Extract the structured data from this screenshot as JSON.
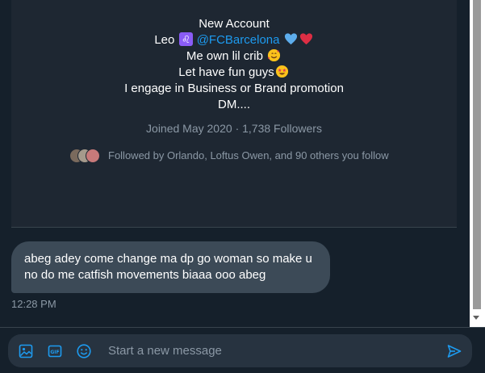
{
  "profile": {
    "bio_lines": [
      "New Account",
      "Leo",
      "@FCBarcelona",
      "Me own lil crib",
      "Let have fun guys",
      "I engage in Business or Brand promotion",
      "DM...."
    ],
    "joined": "Joined May 2020",
    "separator": "·",
    "followers": "1,738 Followers",
    "followed_by": "Followed by Orlando, Loftus Owen, and 90 others you follow"
  },
  "message": {
    "text": "abeg adey come change ma dp go woman so make u no do me catfish movements biaaa ooo abeg",
    "time": "12:28 PM"
  },
  "composer": {
    "placeholder": "Start a new message"
  },
  "icons": {
    "media": "image-icon",
    "gif": "gif-icon",
    "emoji": "emoji-icon",
    "send": "send-icon",
    "zodiac": "leo-icon"
  },
  "colors": {
    "background": "#15202b",
    "card": "#1e2732",
    "accent": "#1d9bf0",
    "bubble": "#3c4a57",
    "muted": "#8b98a5"
  }
}
